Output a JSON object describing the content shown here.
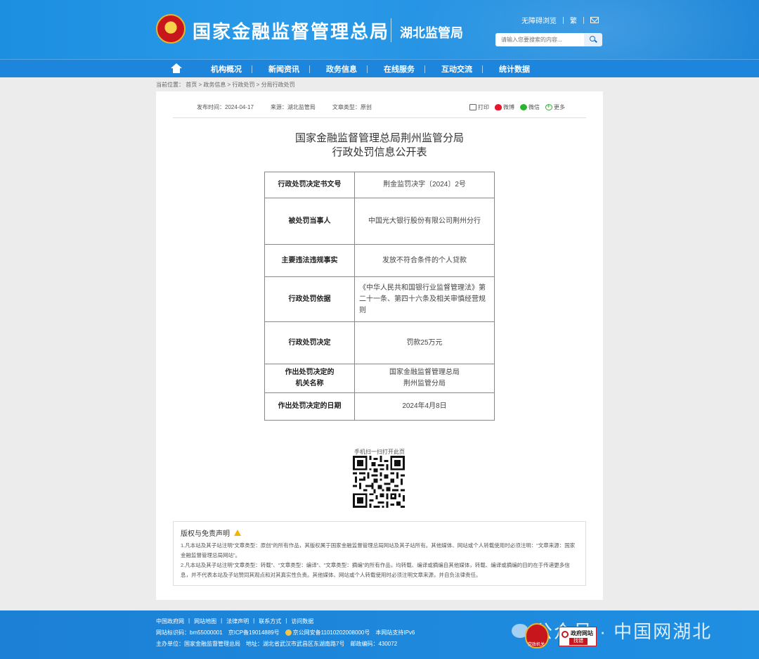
{
  "header": {
    "org_name": "国家金融监督管理总局",
    "bureau_name": "湖北监管局",
    "accessibility": "无障碍浏览",
    "lang": "繁",
    "search_placeholder": "请输入您要搜索的内容..."
  },
  "nav": {
    "items": [
      "机构概况",
      "新闻资讯",
      "政务信息",
      "在线服务",
      "互动交流",
      "统计数据"
    ]
  },
  "breadcrumb": "当前位置：  首页 > 政务信息 > 行政处罚 > 分局行政处罚",
  "meta": {
    "publish_time": "发布时间：2024-04-17",
    "source": "来源：湖北监管局",
    "article_type": "文章类型：原创"
  },
  "actions": {
    "print": "打印",
    "weibo": "微博",
    "wechat": "微信",
    "more": "更多"
  },
  "title": {
    "line1": "国家金融监督管理总局荆州监管分局",
    "line2": "行政处罚信息公开表"
  },
  "table": {
    "rows": [
      {
        "key": "行政处罚决定书文号",
        "value": "荆金监罚决字〔2024〕2号"
      },
      {
        "key": "被处罚当事人",
        "value": "中国光大银行股份有限公司荆州分行"
      },
      {
        "key": "主要违法违规事实",
        "value": "发放不符合条件的个人贷款"
      },
      {
        "key": "行政处罚依据",
        "value": "《中华人民共和国银行业监督管理法》第二十一条、第四十六条及相关审慎经营规则"
      },
      {
        "key": "行政处罚决定",
        "value": "罚款25万元"
      },
      {
        "key1": "作出处罚决定的",
        "key2": "机关名称",
        "value1": "国家金融监督管理总局",
        "value2": "荆州监管分局"
      },
      {
        "key": "作出处罚决定的日期",
        "value": "2024年4月8日"
      }
    ]
  },
  "qr_label": "手机扫一扫打开此页",
  "disclaimer": {
    "title": "版权与免责声明",
    "p1": "1.凡本站及其子站注明“文章类型：原创”的所有作品，其版权属于国家金融监督管理总局网站及其子站所有。其他媒体、网站或个人转载使用时必须注明：“文章来源：国家金融监督管理总局网站”。",
    "p2": "2.凡本站及其子站注明“文章类型：转载”、“文章类型：编译”、“文章类型：摘编”的所有作品，均转载、编译或摘编自其他媒体，转载、编译或摘编的目的在于传递更多信息，并不代表本站及子站赞同其观点和对其真实性负责。其他媒体、网站或个人转载使用时必须注明文章来源，并自负法律责任。"
  },
  "footer": {
    "links": [
      "中国政府网",
      "网站地图",
      "法律声明",
      "联系方式",
      "访问数据"
    ],
    "site_code": "网站标识码：bm55000001",
    "icp": "京ICP备19014889号",
    "police": "京公网安备11010202008000号",
    "ipv6": "本网站支持IPv6",
    "host": "主办单位：国家金融监督管理总局",
    "address": "地址：湖北省武汉市武昌区东湖南路7号",
    "postcode": "邮政编码：430072",
    "gov_badge": "党政机关",
    "find_error_1": "政府网站",
    "find_error_2": "找错",
    "watermark": "公众号 · 中国网湖北"
  }
}
